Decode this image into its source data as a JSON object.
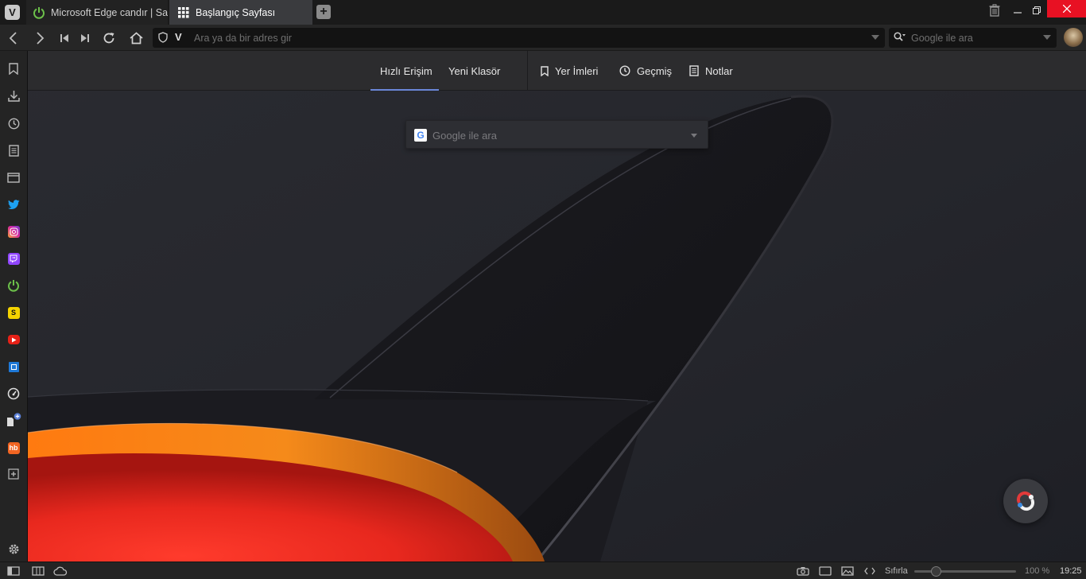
{
  "tabs": [
    {
      "title": "Microsoft Edge candır | Sayfa",
      "icon": "power-icon",
      "active": false
    },
    {
      "title": "Başlangıç Sayfası",
      "icon": "grid-icon",
      "active": true
    }
  ],
  "address_bar": {
    "placeholder": "Ara ya da bir adres gir"
  },
  "search_bar": {
    "placeholder": "Google ile ara"
  },
  "start_page": {
    "nav": {
      "speed_dial": "Hızlı Erişim",
      "new_folder": "Yeni Klasör",
      "bookmarks": "Yer İmleri",
      "history": "Geçmiş",
      "notes": "Notlar"
    },
    "search_placeholder": "Google ile ara",
    "search_engine_letter": "G"
  },
  "sidebar": {
    "panels": [
      {
        "name": "bookmarks-icon"
      },
      {
        "name": "downloads-icon"
      },
      {
        "name": "history-icon"
      },
      {
        "name": "notes-icon"
      },
      {
        "name": "window-icon"
      },
      {
        "name": "twitter-icon"
      },
      {
        "name": "instagram-icon"
      },
      {
        "name": "twitch-icon"
      },
      {
        "name": "power-icon"
      },
      {
        "name": "s-icon",
        "letter": "S"
      },
      {
        "name": "youtube-icon"
      },
      {
        "name": "chip-icon"
      },
      {
        "name": "gauge-icon"
      },
      {
        "name": "page-add-icon"
      },
      {
        "name": "hb-icon",
        "letter": "hb"
      },
      {
        "name": "add-panel-icon"
      }
    ]
  },
  "status_bar": {
    "reset_label": "Sıfırla",
    "zoom_label": "100 %",
    "zoom_value": 100,
    "clock": "19:25"
  },
  "colors": {
    "accent_underline": "#6a86d8",
    "close_button": "#e81123",
    "twitter": "#1da1f2",
    "instagram": "#d6249f",
    "twitch": "#9146ff",
    "power": "#6cc04a",
    "youtube": "#e62117",
    "hb": "#f26522"
  }
}
